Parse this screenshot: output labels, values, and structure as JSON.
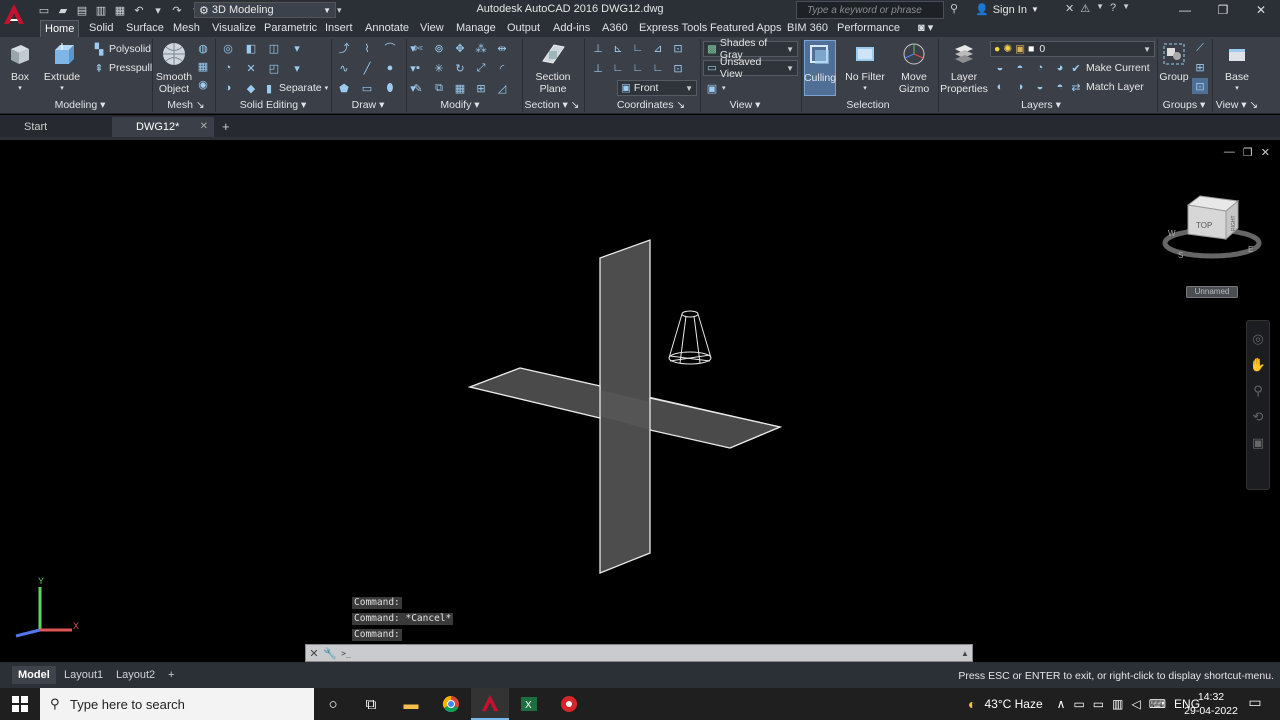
{
  "titlebar": {
    "workspace": "3D Modeling",
    "title": "Autodesk AutoCAD 2016   DWG12.dwg",
    "search_placeholder": "Type a keyword or phrase",
    "sign_in": "Sign In"
  },
  "ribbon_tabs": [
    "Home",
    "Solid",
    "Surface",
    "Mesh",
    "Visualize",
    "Parametric",
    "Insert",
    "Annotate",
    "View",
    "Manage",
    "Output",
    "Add-ins",
    "A360",
    "Express Tools",
    "Featured Apps",
    "BIM 360",
    "Performance"
  ],
  "ribbon": {
    "modeling": {
      "box": "Box",
      "extrude": "Extrude",
      "polysolid": "Polysolid",
      "presspull": "Presspull",
      "label": "Modeling"
    },
    "mesh": {
      "smooth_object_1": "Smooth",
      "smooth_object_2": "Object",
      "label": "Mesh"
    },
    "solid_editing": {
      "separate": "Separate",
      "label": "Solid Editing"
    },
    "draw": {
      "label": "Draw"
    },
    "modify": {
      "label": "Modify"
    },
    "section": {
      "section_plane_1": "Section",
      "section_plane_2": "Plane",
      "label": "Section"
    },
    "coordinates": {
      "view_select": "Front",
      "label": "Coordinates"
    },
    "view": {
      "visual_style": "Shades of Gray",
      "named_view": "Unsaved View",
      "label": "View"
    },
    "selection": {
      "culling": "Culling",
      "no_filter": "No Filter",
      "move_gizmo_1": "Move",
      "move_gizmo_2": "Gizmo",
      "label": "Selection"
    },
    "layers": {
      "layer_properties_1": "Layer",
      "layer_properties_2": "Properties",
      "current_layer": "0",
      "make_current": "Make Current",
      "match_layer": "Match Layer",
      "label": "Layers"
    },
    "groups": {
      "group": "Group",
      "label": "Groups"
    },
    "view2": {
      "base": "Base",
      "label": "View"
    }
  },
  "file_tabs": {
    "start": "Start",
    "drawing": "DWG12*"
  },
  "viewport": {
    "viewcube_face": "TOP",
    "viewcube_side": "RIGHT",
    "viewcube_s": "S",
    "viewcube_e": "E",
    "viewcube_w": "W",
    "ucs_name": "Unnamed",
    "axis_y": "Y",
    "axis_x": "X"
  },
  "command_history": [
    "Command:",
    "Command: *Cancel*",
    "Command:"
  ],
  "command_input": {
    "placeholder": "",
    "prompt_icon": ">_"
  },
  "layout_tabs": [
    "Model",
    "Layout1",
    "Layout2"
  ],
  "status_message": "Press ESC or ENTER to exit, or right-click to display shortcut-menu.",
  "taskbar": {
    "search_placeholder": "Type here to search",
    "weather": "43°C  Haze",
    "language": "ENG",
    "time": "14:32",
    "date": "29-04-2022"
  },
  "colors": {
    "ribbon_bg": "#3b4048",
    "titlebar_bg": "#2b2f36",
    "viewport_bg": "#000000",
    "plane_fill": "#4a4a4a",
    "plane_stroke": "#e8e8e8",
    "autocad_red": "#c8102e"
  }
}
